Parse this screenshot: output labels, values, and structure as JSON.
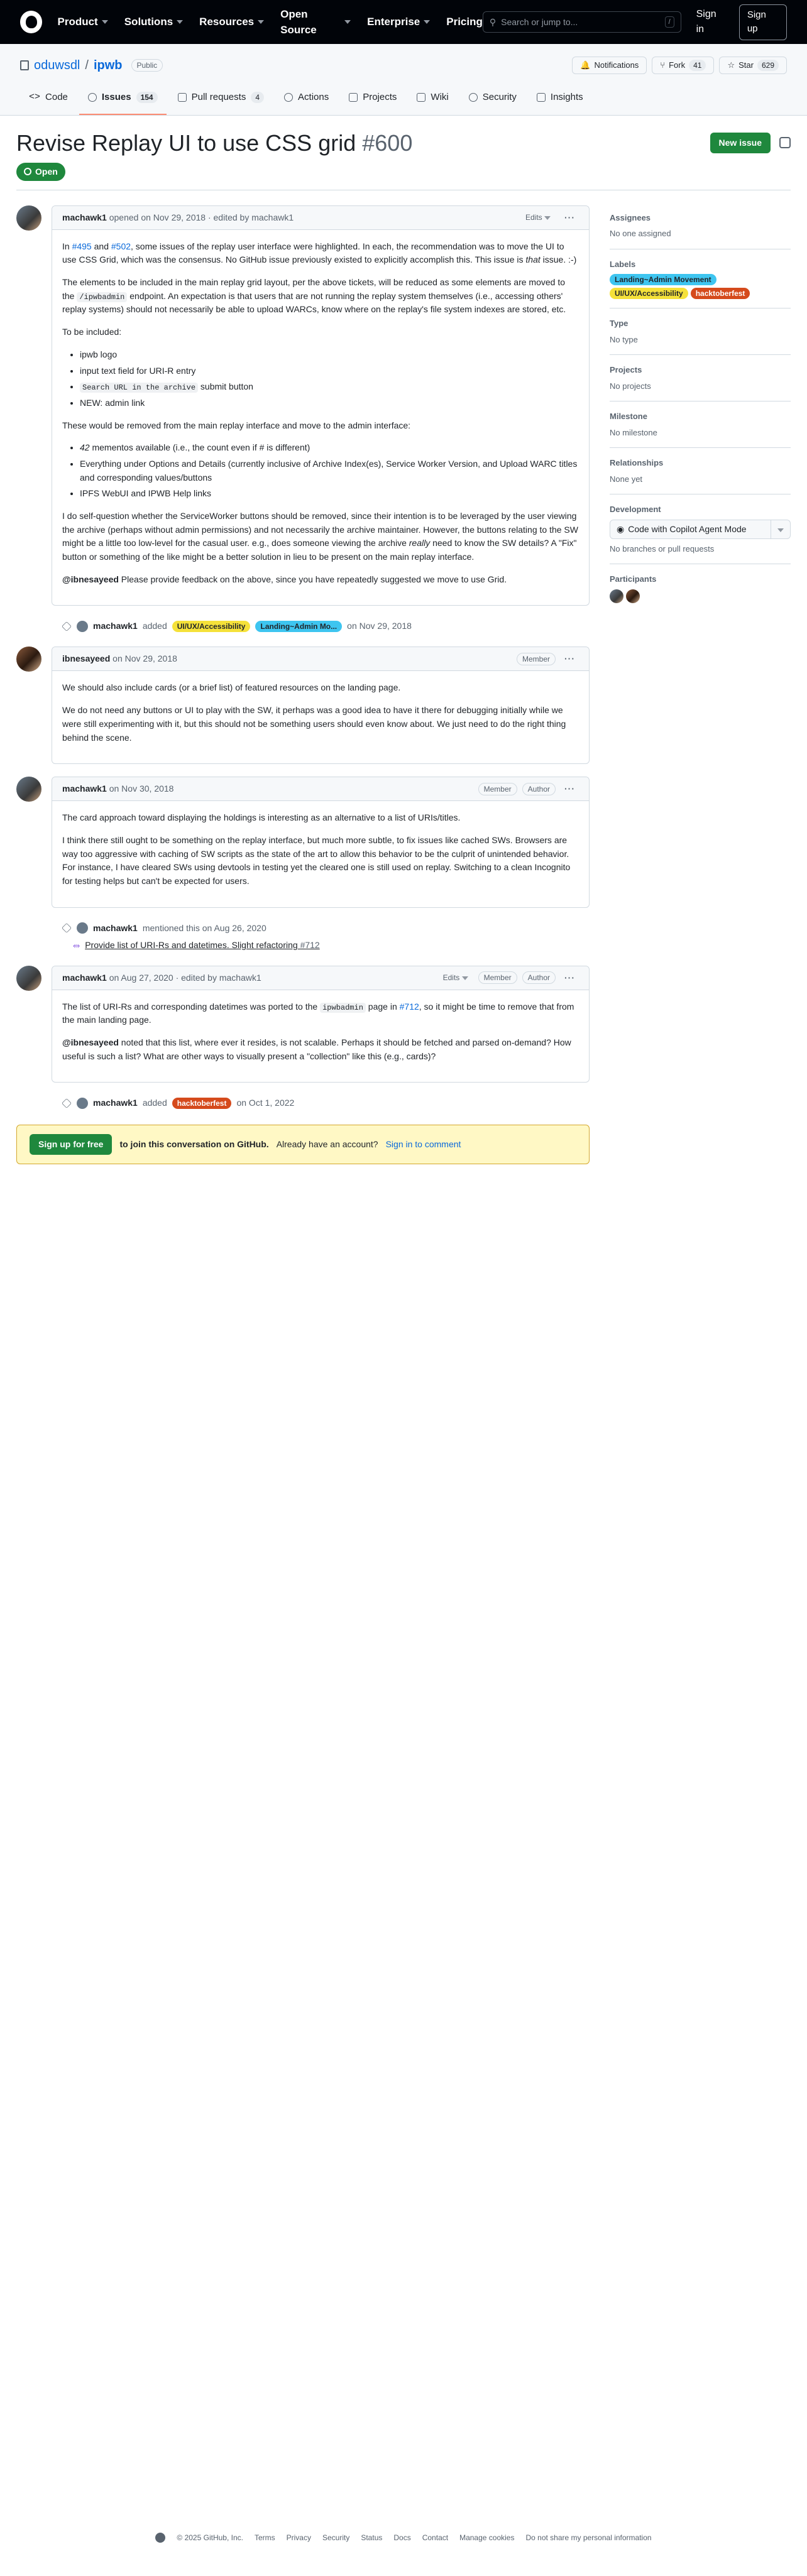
{
  "nav": {
    "items": [
      "Product",
      "Solutions",
      "Resources",
      "Open Source",
      "Enterprise",
      "Pricing"
    ],
    "search_placeholder": "Search or jump to...",
    "search_shortcut": "/",
    "signin": "Sign in",
    "signup": "Sign up"
  },
  "repo": {
    "owner": "oduwsdl",
    "name": "ipwb",
    "visibility": "Public",
    "notifications": "Notifications",
    "fork_label": "Fork",
    "fork_count": "41",
    "star_label": "Star",
    "star_count": "629"
  },
  "tabs": [
    {
      "label": "Code",
      "count": ""
    },
    {
      "label": "Issues",
      "count": "154"
    },
    {
      "label": "Pull requests",
      "count": "4"
    },
    {
      "label": "Actions",
      "count": ""
    },
    {
      "label": "Projects",
      "count": ""
    },
    {
      "label": "Wiki",
      "count": ""
    },
    {
      "label": "Security",
      "count": ""
    },
    {
      "label": "Insights",
      "count": ""
    }
  ],
  "issue": {
    "title": "Revise Replay UI to use CSS grid",
    "number": "#600",
    "new_issue": "New issue",
    "status": "Open"
  },
  "comments": {
    "c1": {
      "author": "machawk1",
      "meta": "opened on Nov 29, 2018 · edited by machawk1",
      "edits": "Edits",
      "p1_a": "In ",
      "p1_link1": "#495",
      "p1_b": " and ",
      "p1_link2": "#502",
      "p1_c": ", some issues of the replay user interface were highlighted. In each, the recommendation was to move the UI to use CSS Grid, which was the consensus. No GitHub issue previously existed to explicitly accomplish this. This issue is ",
      "p1_em": "that",
      "p1_d": " issue. :-)",
      "p2_a": "The elements to be included in the main replay grid layout, per the above tickets, will be reduced as some elements are moved to the ",
      "p2_code": "/ipwbadmin",
      "p2_b": " endpoint. An expectation is that users that are not running the replay system themselves (i.e., accessing others' replay systems) should not necessarily be able to upload WARCs, know where on the replay's file system indexes are stored, etc.",
      "p3": "To be included:",
      "inc1": "ipwb logo",
      "inc2": "input text field for URI-R entry",
      "inc3_code": "Search URL in the archive",
      "inc3_b": " submit button",
      "inc4": "NEW: admin link",
      "p4": "These would be removed from the main replay interface and move to the admin interface:",
      "rem1_em": "42",
      "rem1_b": " mementos available (i.e., the count even if # is different)",
      "rem2": "Everything under Options and Details (currently inclusive of Archive Index(es), Service Worker Version, and Upload WARC titles and corresponding values/buttons",
      "rem3": "IPFS WebUI and IPWB Help links",
      "p5_a": "I do self-question whether the ServiceWorker buttons should be removed, since their intention is to be leveraged by the user viewing the archive (perhaps without admin permissions) and not necessarily the archive maintainer. However, the buttons relating to the SW might be a little too low-level for the casual user. e.g., does someone viewing the archive ",
      "p5_em": "really",
      "p5_b": " need to know the SW details? A \"Fix\" button or something of the like might be a better solution in lieu to be present on the main replay interface.",
      "p6_mention": "@ibnesayeed",
      "p6_b": " Please provide feedback on the above, since you have repeatedly suggested we move to use Grid."
    },
    "ev1": {
      "author": "machawk1",
      "action": "added",
      "label1": "UI/UX/Accessibility",
      "label2": "Landing~Admin Mo...",
      "date": "on Nov 29, 2018"
    },
    "c2": {
      "author": "ibnesayeed",
      "meta": "on Nov 29, 2018",
      "role": "Member",
      "p1": "We should also include cards (or a brief list) of featured resources on the landing page.",
      "p2": "We do not need any buttons or UI to play with the SW, it perhaps was a good idea to have it there for debugging initially while we were still experimenting with it, but this should not be something users should even know about. We just need to do the right thing behind the scene."
    },
    "c3": {
      "author": "machawk1",
      "meta": "on Nov 30, 2018",
      "role": "Member",
      "role2": "Author",
      "p1": "The card approach toward displaying the holdings is interesting as an alternative to a list of URIs/titles.",
      "p2": "I think there still ought to be something on the replay interface, but much more subtle, to fix issues like cached SWs. Browsers are way too aggressive with caching of SW scripts as the state of the art to allow this behavior to be the culprit of unintended behavior. For instance, I have cleared SWs using devtools in testing yet the cleared one is still used on replay. Switching to a clean Incognito for testing helps but can't be expected for users."
    },
    "ev2": {
      "author": "machawk1",
      "action": "mentioned this on Aug 26, 2020",
      "ref_title": "Provide list of URI-Rs and datetimes. Slight refactoring",
      "ref_num": "#712"
    },
    "c4": {
      "author": "machawk1",
      "meta": "on Aug 27, 2020 · edited by machawk1",
      "edits": "Edits",
      "role": "Member",
      "role2": "Author",
      "p1_a": "The list of URI-Rs and corresponding datetimes was ported to the ",
      "p1_code": "ipwbadmin",
      "p1_b": " page in ",
      "p1_link": "#712",
      "p1_c": ", so it might be time to remove that from the main landing page.",
      "p2_mention": "@ibnesayeed",
      "p2_b": " noted that this list, where ever it resides, is not scalable. Perhaps it should be fetched and parsed on-demand? How useful is such a list? What are other ways to visually present a \"collection\" like this (e.g., cards)?"
    },
    "ev3": {
      "author": "machawk1",
      "action": "added",
      "label": "hacktoberfest",
      "date": "on Oct 1, 2022"
    }
  },
  "signup_bar": {
    "button": "Sign up for free",
    "text_bold": "to join this conversation on GitHub.",
    "text": "Already have an account?",
    "link": "Sign in to comment"
  },
  "sidebar": {
    "assignees_h": "Assignees",
    "assignees_v": "No one assigned",
    "labels_h": "Labels",
    "labels": [
      "Landing~Admin Movement",
      "UI/UX/Accessibility",
      "hacktoberfest"
    ],
    "type_h": "Type",
    "type_v": "No type",
    "projects_h": "Projects",
    "projects_v": "No projects",
    "milestone_h": "Milestone",
    "milestone_v": "No milestone",
    "rel_h": "Relationships",
    "rel_v": "None yet",
    "dev_h": "Development",
    "copilot": "Code with Copilot Agent Mode",
    "dev_v": "No branches or pull requests",
    "participants_h": "Participants"
  },
  "colors": {
    "label_landing": "#3ec5f0",
    "label_uiux": "#f5e13a",
    "label_hacktoberfest": "#d54a1c",
    "open_green": "#1f883d"
  },
  "footer": [
    "© 2025 GitHub, Inc.",
    "Terms",
    "Privacy",
    "Security",
    "Status",
    "Docs",
    "Contact",
    "Manage cookies",
    "Do not share my personal information"
  ]
}
